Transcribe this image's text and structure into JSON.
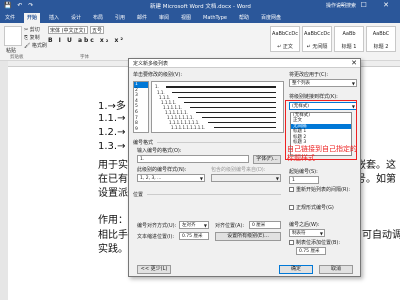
{
  "titlebar": {
    "quick_access": "💾 ↶ ↷",
    "title": "新建 Microsoft Word 文档.docx - Word",
    "user": "操作说明搜索",
    "window_controls": "— ☐ ✕"
  },
  "tabs": [
    "文件",
    "开始",
    "插入",
    "设计",
    "布局",
    "引用",
    "邮件",
    "审阅",
    "视图",
    "MathType",
    "帮助",
    "百度网盘"
  ],
  "ribbon": {
    "paste": "粘贴",
    "clipboard_items": [
      "✂ 剪切",
      "⎘ 复制",
      "🖌 格式刷"
    ],
    "font_name": "宋体 (中文正文)",
    "font_size": "五号",
    "format_buttons": "B I U abc x₂ x²",
    "clipboard_label": "剪贴板",
    "font_label": "字体",
    "styles": [
      {
        "sample": "AaBbCcDc",
        "name": "↵ 正文"
      },
      {
        "sample": "AaBbCcDc",
        "name": "↵ 无间隔"
      },
      {
        "sample": "AaBb",
        "name": "标题 1"
      },
      {
        "sample": "AaBbC",
        "name": "标题 2"
      }
    ]
  },
  "document": {
    "lines": [
      "1.→多",
      "1.1.→",
      "1.2.→",
      "1.3.→",
      "用于实",
      "在已有",
      "设置派",
      "作用：",
      "相比手",
      "实践。"
    ],
    "right_fragments": [
      "嵌套。这",
      "号。如第 1"
    ],
    "right_fragment_2": "可自动调"
  },
  "dialog": {
    "title": "定义新多级列表",
    "close": "✕",
    "level_label": "单击要修改的级别(V):",
    "levels": [
      "1",
      "2",
      "3",
      "4",
      "5",
      "6",
      "7",
      "8",
      "9"
    ],
    "apply_label": "将更改应用于(C):",
    "apply_value": "整个列表",
    "link_label": "将级别链接到样式(K):",
    "link_value": "(无样式)",
    "gallery_label": "要在库中显示的级别(H):",
    "gallery_value": "级别 1",
    "list_name_label": "ListNum 域列表名(T):",
    "preview_numbers": [
      "1.",
      "1.1.",
      "1.1.1.",
      "1.1.1.1.",
      "1.1.1.1.1.",
      "1.1.1.1.1.1.",
      "1.1.1.1.1.1.1.",
      "1.1.1.1.1.1.1.1.",
      "1.1.1.1.1.1.1.1.1."
    ],
    "number_format_section": "编号格式",
    "number_format_label": "输入编号的格式(O):",
    "number_format_value": "1.",
    "font_button": "字体(F)...",
    "number_style_label": "此级别的编号样式(N):",
    "number_style_value": "1, 2, 3, ...",
    "include_level_label": "包含的级别编号来自(D):",
    "start_at_label": "起始编号(S):",
    "start_at_value": "1",
    "restart_label": "重新开始列表的间隔(R):",
    "legal_label": "正规形式编号(G)",
    "position_section": "位置",
    "alignment_label": "编号对齐方式(U):",
    "alignment_value": "左对齐",
    "align_at_label": "对齐位置(A):",
    "align_at_value": "0 厘米",
    "indent_label": "文本缩进位置(I):",
    "indent_value": "0.75 厘米",
    "set_all_button": "设置所有级别(E)...",
    "follow_label": "编号之后(W):",
    "follow_value": "制表符",
    "tab_stop_label": "制表位添加位置(B):",
    "tab_stop_value": "0.75 厘米",
    "less_button": "<< 更少(L)",
    "ok_button": "确定",
    "cancel_button": "取消",
    "dropdown_options": [
      "(无样式)",
      "正文",
      "无间隔",
      "标题 1",
      "标题 2",
      "标题 3"
    ],
    "dropdown_selected_index": 2
  },
  "annotation": "自己链接到自己指定的标题样式",
  "colors": {
    "accent": "#2b579a",
    "selection": "#0078d7",
    "annotation": "#e22222"
  }
}
